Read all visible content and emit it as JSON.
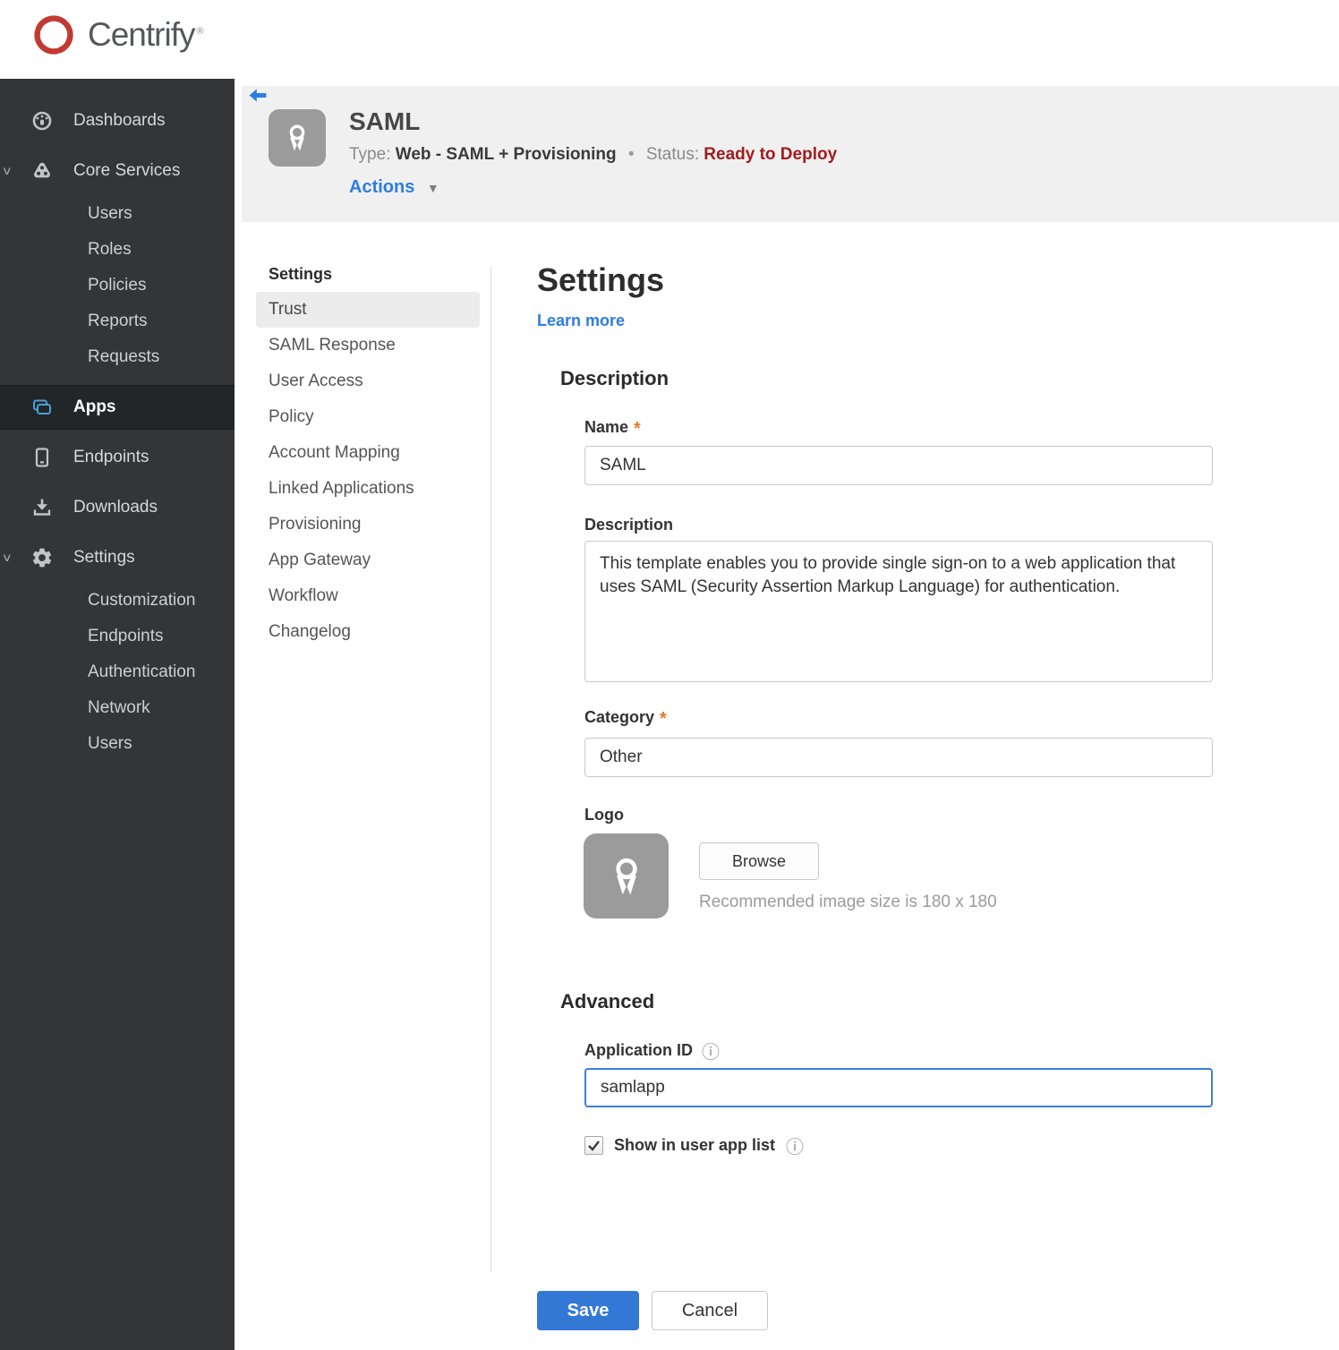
{
  "brand": {
    "name": "Centrify",
    "mark": "®"
  },
  "icons": {
    "info": "ⓘ",
    "dropdown_arrow": "▼",
    "section_chevron": "∨",
    "bullet": "•"
  },
  "colors": {
    "accent_blue": "#2e7ce0",
    "button_blue": "#3478d6",
    "status_red": "#a21c1c",
    "required_orange": "#e8782a",
    "sidebar_bg": "#333539",
    "sidebar_active_bg": "#232629",
    "header_band": "#f0f0f1",
    "app_icon_gray": "#9b9b9b",
    "apps_icon_blue": "#47a3da"
  },
  "sidebar": {
    "dashboards": "Dashboards",
    "core_services": "Core Services",
    "core_children": [
      "Users",
      "Roles",
      "Policies",
      "Reports",
      "Requests"
    ],
    "apps": "Apps",
    "endpoints": "Endpoints",
    "downloads": "Downloads",
    "settings": "Settings",
    "settings_children": [
      "Customization",
      "Endpoints",
      "Authentication",
      "Network",
      "Users"
    ]
  },
  "app_header": {
    "title": "SAML",
    "type_label": "Type:",
    "type_value": "Web - SAML + Provisioning",
    "status_label": "Status:",
    "status_value": "Ready to Deploy",
    "actions_label": "Actions"
  },
  "subnav": {
    "header": "Settings",
    "selected": "Trust",
    "items": [
      "Trust",
      "SAML Response",
      "User Access",
      "Policy",
      "Account Mapping",
      "Linked Applications",
      "Provisioning",
      "App Gateway",
      "Workflow",
      "Changelog"
    ]
  },
  "main": {
    "heading": "Settings",
    "learn_more": "Learn more",
    "description_section": {
      "heading": "Description",
      "name_label": "Name",
      "required_mark": "*",
      "name_value": "SAML",
      "description_label": "Description",
      "description_value": "This template enables you to provide single sign-on to a web application that uses SAML (Security Assertion Markup Language) for authentication.",
      "category_label": "Category",
      "category_value": "Other",
      "logo_label": "Logo",
      "browse_label": "Browse",
      "logo_hint": "Recommended image size is 180 x 180"
    },
    "advanced_section": {
      "heading": "Advanced",
      "app_id_label": "Application ID",
      "app_id_value": "samlapp",
      "show_label": "Show in user app list",
      "checkbox_checked": true
    },
    "footer": {
      "save_label": "Save",
      "cancel_label": "Cancel"
    }
  }
}
